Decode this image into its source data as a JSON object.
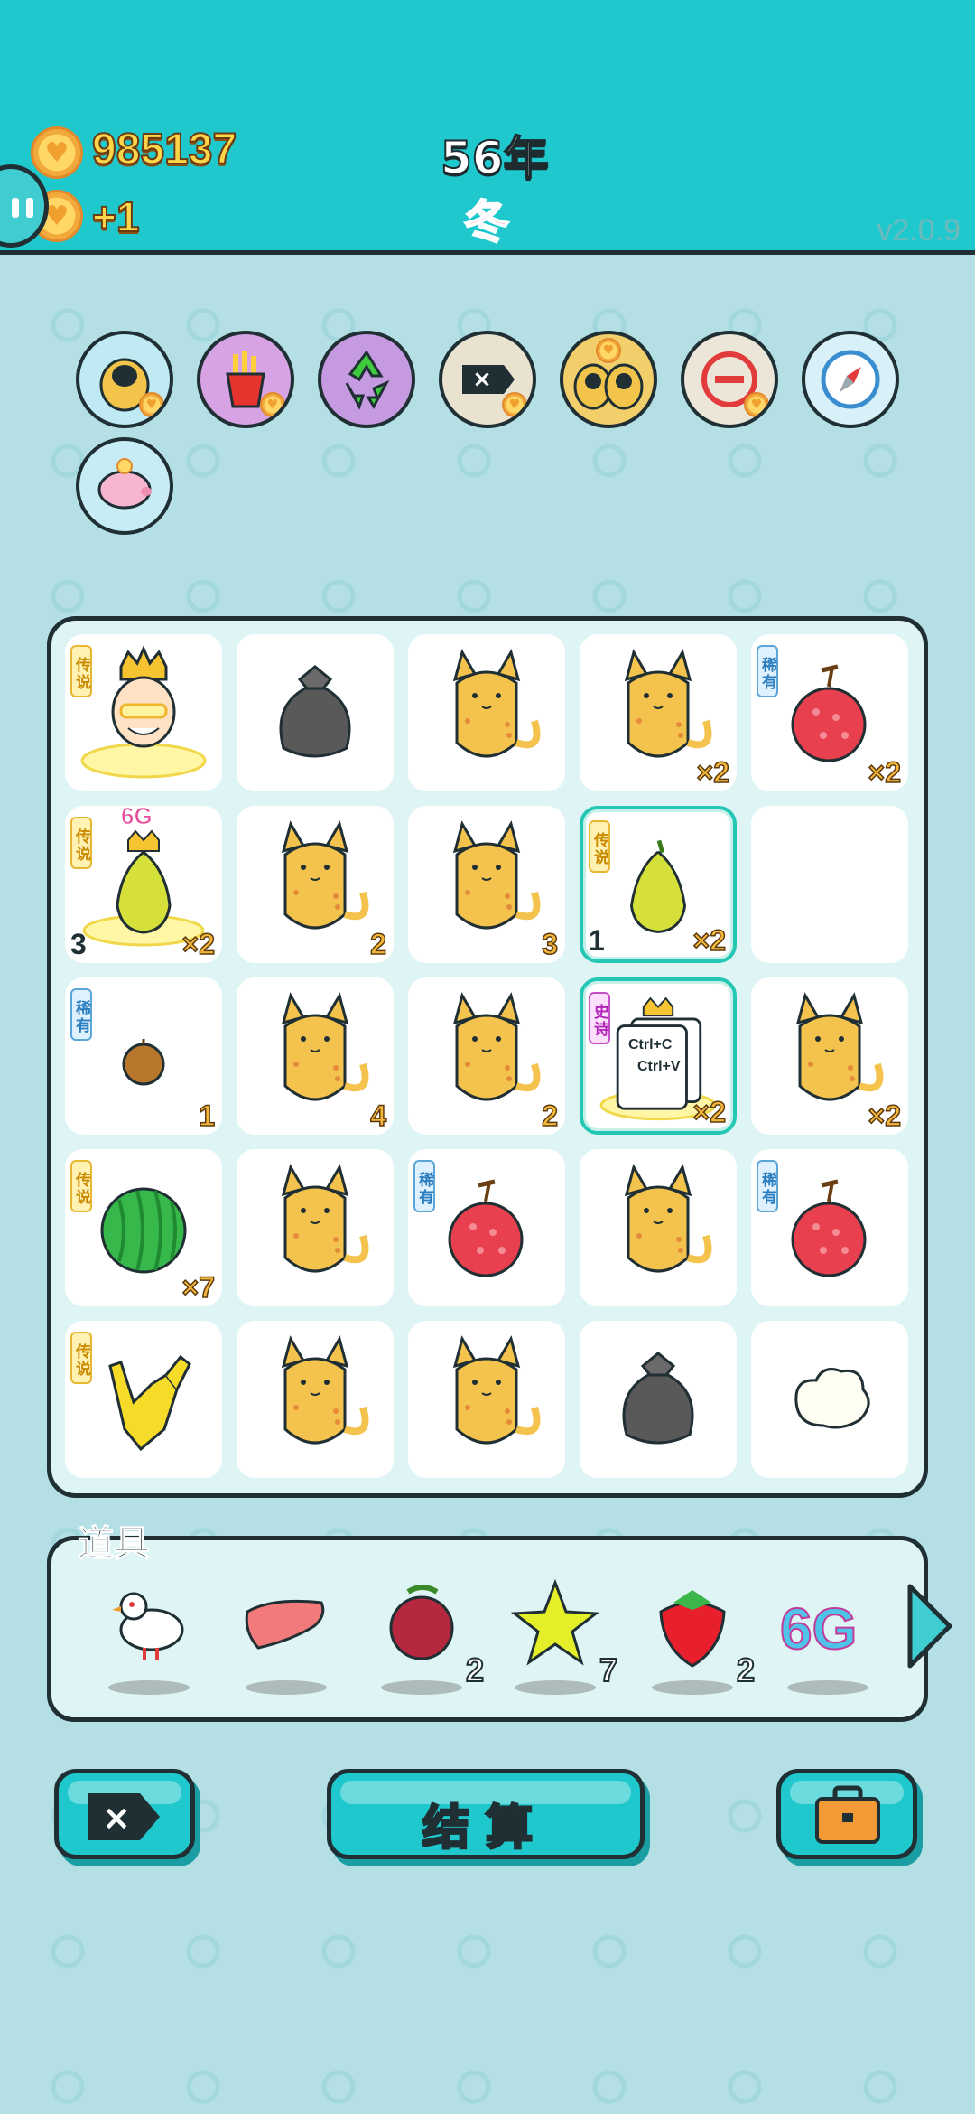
{
  "header": {
    "money": "985137",
    "income": "+1",
    "year": "56年",
    "season": "冬",
    "version": "v2.0.9"
  },
  "abilities": [
    {
      "name": "cat-hole"
    },
    {
      "name": "fries"
    },
    {
      "name": "recycle"
    },
    {
      "name": "remove-tag"
    },
    {
      "name": "double-cat"
    },
    {
      "name": "minus"
    },
    {
      "name": "compass"
    },
    {
      "name": "piggy-bank"
    }
  ],
  "board": {
    "tags": {
      "legend": "传说",
      "rare": "稀有",
      "epic": "史诗"
    },
    "cells": [
      {
        "item": "king",
        "tag": "legend",
        "count": ""
      },
      {
        "item": "trash-bag",
        "tag": "",
        "count": ""
      },
      {
        "item": "cat",
        "tag": "",
        "count": ""
      },
      {
        "item": "cat",
        "tag": "",
        "count": "×2"
      },
      {
        "item": "lychee",
        "tag": "rare",
        "count": "×2"
      },
      {
        "item": "pear-6g",
        "tag": "legend",
        "count": "×2",
        "lvl": "3",
        "crown_text": "6G"
      },
      {
        "item": "cat",
        "tag": "",
        "count": "2"
      },
      {
        "item": "cat",
        "tag": "",
        "count": "3"
      },
      {
        "item": "pear",
        "tag": "legend",
        "count": "×2",
        "lvl": "1",
        "highlight": true
      },
      {
        "item": "empty",
        "tag": "",
        "count": ""
      },
      {
        "item": "nut",
        "tag": "rare",
        "count": "1"
      },
      {
        "item": "cat",
        "tag": "",
        "count": "4"
      },
      {
        "item": "cat",
        "tag": "",
        "count": "2"
      },
      {
        "item": "copy-paste",
        "tag": "epic",
        "count": "×2",
        "highlight": true,
        "line1": "Ctrl+C",
        "line2": "Ctrl+V"
      },
      {
        "item": "cat",
        "tag": "",
        "count": "×2"
      },
      {
        "item": "watermelon",
        "tag": "legend",
        "count": "×7"
      },
      {
        "item": "cat",
        "tag": "",
        "count": ""
      },
      {
        "item": "lychee",
        "tag": "rare",
        "count": ""
      },
      {
        "item": "cat",
        "tag": "",
        "count": ""
      },
      {
        "item": "lychee",
        "tag": "rare",
        "count": ""
      },
      {
        "item": "rock-hand",
        "tag": "legend",
        "count": ""
      },
      {
        "item": "cat",
        "tag": "",
        "count": ""
      },
      {
        "item": "cat",
        "tag": "",
        "count": ""
      },
      {
        "item": "trash-bag",
        "tag": "",
        "count": ""
      },
      {
        "item": "cotton",
        "tag": "",
        "count": ""
      }
    ]
  },
  "tools": {
    "title": "道具",
    "items": [
      {
        "name": "dove",
        "count": ""
      },
      {
        "name": "liver",
        "count": ""
      },
      {
        "name": "bayberry",
        "count": "2"
      },
      {
        "name": "star",
        "count": "7"
      },
      {
        "name": "strawberry",
        "count": "2"
      },
      {
        "name": "6g-logo",
        "count": "",
        "text": "6G"
      }
    ]
  },
  "buttons": {
    "settle": "结算"
  },
  "colors": {
    "header": "#1ec8cd",
    "accent_gold": "#ffd54a",
    "outline": "#1f2f34",
    "background": "#b3dfe5"
  }
}
